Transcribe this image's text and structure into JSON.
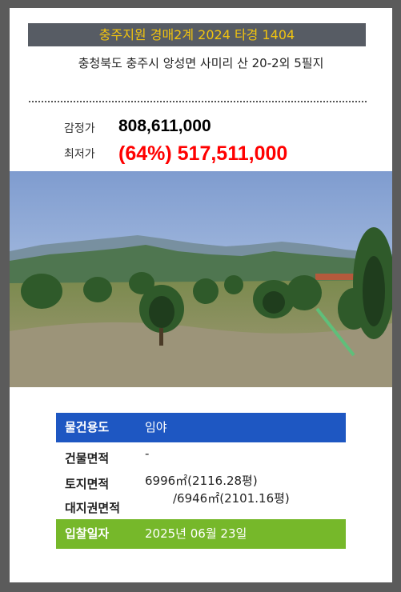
{
  "header": {
    "title": "충주지원 경매2계 2024 타경 1404",
    "address": "충청북도 충주시 앙성면 사미리 산 20-2외 5필지"
  },
  "prices": {
    "appraisal_label": "감정가",
    "appraisal_value": "808,611,000",
    "minimum_label": "최저가",
    "minimum_value": "(64%) 517,511,000"
  },
  "details": {
    "usage_label": "물건용도",
    "usage_value": "임야",
    "building_label": "건물면적",
    "building_value": "-",
    "land_label": "토지면적",
    "land_value": "6996㎡(2116.28평)",
    "land_right_label": "대지권면적",
    "land_right_value": "/6946㎡(2101.16평)",
    "bid_date_label": "입찰일자",
    "bid_date_value": "2025년 06월 23일"
  },
  "colors": {
    "title_bg": "#575c64",
    "title_text": "#f1c40f",
    "min_price": "#ff0000",
    "usage_bg": "#1e57c2",
    "date_bg": "#76b82a"
  }
}
